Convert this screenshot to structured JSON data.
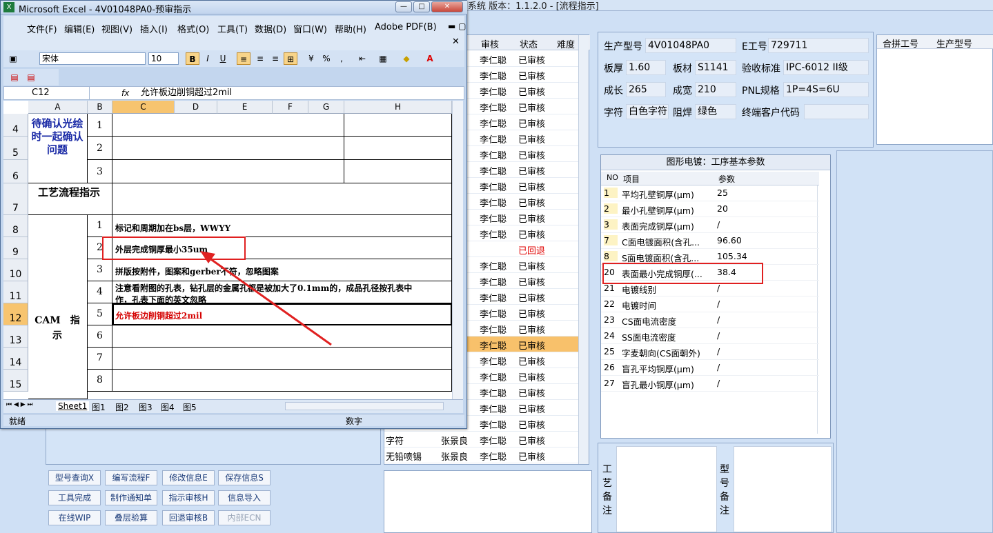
{
  "background_app": {
    "title": "系统  版本：1.1.2.0 - [流程指示]",
    "flow_grid": {
      "headers": [
        "审核",
        "状态",
        "难度"
      ],
      "rows": [
        {
          "name": "",
          "maker": "",
          "auditor": "李仁聪",
          "status": "已审核"
        },
        {
          "name": "",
          "maker": "",
          "auditor": "李仁聪",
          "status": "已审核"
        },
        {
          "name": "",
          "maker": "",
          "auditor": "李仁聪",
          "status": "已审核"
        },
        {
          "name": "",
          "maker": "",
          "auditor": "李仁聪",
          "status": "已审核"
        },
        {
          "name": "",
          "maker": "",
          "auditor": "李仁聪",
          "status": "已审核"
        },
        {
          "name": "",
          "maker": "",
          "auditor": "李仁聪",
          "status": "已审核"
        },
        {
          "name": "",
          "maker": "",
          "auditor": "李仁聪",
          "status": "已审核"
        },
        {
          "name": "",
          "maker": "",
          "auditor": "李仁聪",
          "status": "已审核"
        },
        {
          "name": "",
          "maker": "",
          "auditor": "李仁聪",
          "status": "已审核"
        },
        {
          "name": "",
          "maker": "",
          "auditor": "李仁聪",
          "status": "已审核"
        },
        {
          "name": "",
          "maker": "",
          "auditor": "李仁聪",
          "status": "已审核"
        },
        {
          "name": "",
          "maker": "",
          "auditor": "李仁聪",
          "status": "已审核"
        },
        {
          "name": "",
          "maker": "",
          "auditor": "",
          "status": "已回退"
        },
        {
          "name": "",
          "maker": "",
          "auditor": "李仁聪",
          "status": "已审核"
        },
        {
          "name": "",
          "maker": "",
          "auditor": "李仁聪",
          "status": "已审核"
        },
        {
          "name": "",
          "maker": "",
          "auditor": "李仁聪",
          "status": "已审核"
        },
        {
          "name": "",
          "maker": "",
          "auditor": "李仁聪",
          "status": "已审核"
        },
        {
          "name": "",
          "maker": "",
          "auditor": "李仁聪",
          "status": "已审核"
        },
        {
          "name": "",
          "maker": "",
          "auditor": "李仁聪",
          "status": "已审核"
        },
        {
          "name": "",
          "maker": "",
          "auditor": "李仁聪",
          "status": "已审核"
        },
        {
          "name": "",
          "maker": "",
          "auditor": "李仁聪",
          "status": "已审核"
        },
        {
          "name": "",
          "maker": "",
          "auditor": "李仁聪",
          "status": "已审核"
        },
        {
          "name": "",
          "maker": "",
          "auditor": "李仁聪",
          "status": "已审核"
        },
        {
          "name": "",
          "maker": "",
          "auditor": "李仁聪",
          "status": "已审核"
        },
        {
          "name": "字符",
          "maker": "张景良",
          "auditor": "李仁聪",
          "status": "已审核"
        },
        {
          "name": "无铅喷锡",
          "maker": "张景良",
          "auditor": "李仁聪",
          "status": "已审核"
        }
      ]
    },
    "buttons": [
      [
        "型号查询X",
        "编写流程F",
        "修改信息E",
        "保存信息S"
      ],
      [
        "工具完成",
        "制作通知单",
        "指示审核H",
        "信息导入"
      ],
      [
        "在线WIP",
        "叠层验算",
        "回退审核B",
        "内部ECN"
      ]
    ],
    "info": {
      "model_label": "生产型号",
      "model": "4V01048PA0",
      "eno_label": "E工号",
      "eno": "729711",
      "thick_label": "板厚",
      "thick": "1.60",
      "material_label": "板材",
      "material": "S1141",
      "std_label": "验收标准",
      "std": "IPC-6012 II级",
      "len_label": "成长",
      "len": "265",
      "wid_label": "成宽",
      "wid": "210",
      "pnl_label": "PNL规格",
      "pnl": "1P=4S=6U",
      "char_label": "字符",
      "char": "白色字符",
      "mask_label": "阻焊",
      "mask": "绿色",
      "cust_label": "终端客户代码",
      "cust": ""
    },
    "merge_headers": [
      "合拼工号",
      "生产型号"
    ],
    "params": {
      "caption": "图形电镀：工序基本参数",
      "headers": [
        "NO",
        "项目",
        "参数"
      ],
      "rows": [
        {
          "no": "1",
          "name": "平均孔壁铜厚(μm)",
          "value": "25"
        },
        {
          "no": "2",
          "name": "最小孔壁铜厚(μm)",
          "value": "20"
        },
        {
          "no": "3",
          "name": "表面完成铜厚(μm)",
          "value": "/"
        },
        {
          "no": "7",
          "name": "C面电镀面积(含孔...",
          "value": "96.60"
        },
        {
          "no": "8",
          "name": "S面电镀面积(含孔...",
          "value": "105.34"
        },
        {
          "no": "20",
          "name": "表面最小完成铜厚(...",
          "value": "38.4"
        },
        {
          "no": "21",
          "name": "电镀线别",
          "value": "/"
        },
        {
          "no": "22",
          "name": "电镀时间",
          "value": "/"
        },
        {
          "no": "23",
          "name": "CS面电流密度",
          "value": "/"
        },
        {
          "no": "24",
          "name": "SS面电流密度",
          "value": "/"
        },
        {
          "no": "25",
          "name": "字麦朝向(CS面朝外)",
          "value": "/"
        },
        {
          "no": "26",
          "name": "盲孔平均铜厚(μm)",
          "value": "/"
        },
        {
          "no": "27",
          "name": "盲孔最小铜厚(μm)",
          "value": "/"
        }
      ]
    },
    "remark1": "工艺备注",
    "remark2": "型号备注"
  },
  "excel": {
    "title": "Microsoft Excel - 4V01048PA0-预审指示",
    "menu": [
      "文件(F)",
      "编辑(E)",
      "视图(V)",
      "插入(I)",
      "格式(O)",
      "工具(T)",
      "数据(D)",
      "窗口(W)",
      "帮助(H)",
      "Adobe PDF(B)"
    ],
    "font_name": "宋体",
    "font_size": "10",
    "cell_ref": "C12",
    "formula": "允许板边削铜超过2mil",
    "fx": "fx",
    "columns": [
      "A",
      "B",
      "C",
      "D",
      "E",
      "F",
      "G",
      "H"
    ],
    "rows": [
      "4",
      "5",
      "6",
      "7",
      "8",
      "9",
      "10",
      "11",
      "12",
      "13",
      "14",
      "15"
    ],
    "a4": "待确认光绘时一起确认问题",
    "a7": "工艺流程指示",
    "a_cam": "CAM　指示",
    "nums": [
      "1",
      "2",
      "3",
      "1",
      "2",
      "3",
      "4",
      "5",
      "6",
      "7",
      "8"
    ],
    "texts": [
      "标记和周期加在bs层，WWYY",
      "外层完成铜厚最小35um",
      "拼版按附件，图案和gerber不符，忽略图案",
      "注意看附图的孔表，钻孔层的金属孔都是被加大了0.1mm的，成品孔径按孔表中",
      "作，孔表下面的英文忽略",
      "允许板边削铜超过2mil"
    ],
    "sheets": [
      "Sheet1",
      "图1",
      "图2",
      "图3",
      "图4",
      "图5"
    ],
    "status_left": "就绪",
    "status_num": "数字"
  }
}
